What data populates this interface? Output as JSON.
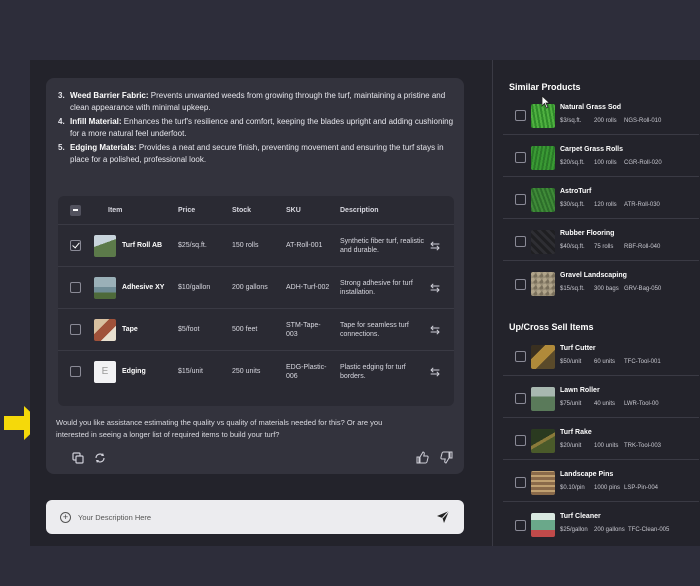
{
  "steps": [
    {
      "num": "3.",
      "title": "Weed Barrier Fabric:",
      "text": " Prevents unwanted weeds from growing through the turf, maintaining a pristine and clean appearance with minimal upkeep."
    },
    {
      "num": "4.",
      "title": "Infill Material:",
      "text": " Enhances the turf's resilience and comfort, keeping the blades upright and adding cushioning for a more natural feel underfoot."
    },
    {
      "num": "5.",
      "title": "Edging Materials:",
      "text": " Provides a neat and secure finish, preventing movement and ensuring the turf stays in place for a polished, professional look."
    }
  ],
  "table": {
    "headers": {
      "item": "Item",
      "price": "Price",
      "stock": "Stock",
      "sku": "SKU",
      "description": "Description"
    },
    "rows": [
      {
        "name": "Turf Roll AB",
        "price": "$25/sq.ft.",
        "stock": "150 rolls",
        "sku": "AT-Roll-001",
        "description": "Synthetic fiber turf, realistic and durable.",
        "checked": true,
        "thumb_color": "#5c7a4a"
      },
      {
        "name": "Adhesive XY",
        "price": "$10/gallon",
        "stock": "200 gallons",
        "sku": "ADH-Turf-002",
        "description": "Strong adhesive for turf installation.",
        "checked": false,
        "thumb_color": "#6f8c96"
      },
      {
        "name": "Tape",
        "price": "$5/foot",
        "stock": "500 feet",
        "sku": "STM-Tape-003",
        "description": "Tape for seamless turf connections.",
        "checked": false,
        "thumb_color": "#a0523a"
      },
      {
        "name": "Edging",
        "price": "$15/unit",
        "stock": "250 units",
        "sku": "EDG-Plastic-006",
        "description": "Plastic edging for turf borders.",
        "checked": false,
        "thumb_letter": "E",
        "thumb_color": "#f2f2f4"
      }
    ]
  },
  "followup": "Would you like assistance estimating the quality vs quality of materials needed for this? Or are you interested in seeing a longer list of required items to build your turf?",
  "input": {
    "placeholder": "Your Description Here"
  },
  "similar": {
    "title": "Similar Products",
    "items": [
      {
        "name": "Natural Grass Sod",
        "price": "$3/sq.ft.",
        "qty": "200 rolls",
        "sku": "NGS-Roll-010",
        "color": "#2f8a2a"
      },
      {
        "name": "Carpet Grass Rolls",
        "price": "$20/sq.ft.",
        "qty": "100 rolls",
        "sku": "CGR-Roll-020",
        "color": "#3a9a34"
      },
      {
        "name": "AstroTurf",
        "price": "$30/sq.ft.",
        "qty": "120 rolls",
        "sku": "ATR-Roll-030",
        "color": "#2c6e2a"
      },
      {
        "name": "Rubber Flooring",
        "price": "$40/sq.ft.",
        "qty": "75 rolls",
        "sku": "RBF-Roll-040",
        "color": "#1f1f22"
      },
      {
        "name": "Gravel Landscaping",
        "price": "$15/sq.ft.",
        "qty": "300 bags",
        "sku": "GRV-Bag-050",
        "color": "#9a8f78"
      }
    ]
  },
  "upsell": {
    "title": "Up/Cross Sell Items",
    "items": [
      {
        "name": "Turf Cutter",
        "price": "$50/unit",
        "qty": "60 units",
        "sku": "TFC-Tool-001",
        "color": "#8a6a2a"
      },
      {
        "name": "Lawn Roller",
        "price": "$75/unit",
        "qty": "40 units",
        "sku": "LWR-Tool-00",
        "color": "#5a7a5a"
      },
      {
        "name": "Turf Rake",
        "price": "$20/unit",
        "qty": "100 units",
        "sku": "TRK-Tool-003",
        "color": "#6a5a2a"
      },
      {
        "name": "Landscape Pins",
        "price": "$0.10/pin",
        "qty": "1000 pins",
        "sku": "LSP-Pin-004",
        "color": "#8a6a4a"
      },
      {
        "name": "Turf Cleaner",
        "price": "$25/gallon",
        "qty": "200 gallons",
        "sku": "TFC-Clean-005",
        "color": "#6aa88a"
      }
    ]
  },
  "colors": {
    "arrow": "#f5d90a",
    "panel": "#33333d",
    "background": "#2d2d3a"
  }
}
